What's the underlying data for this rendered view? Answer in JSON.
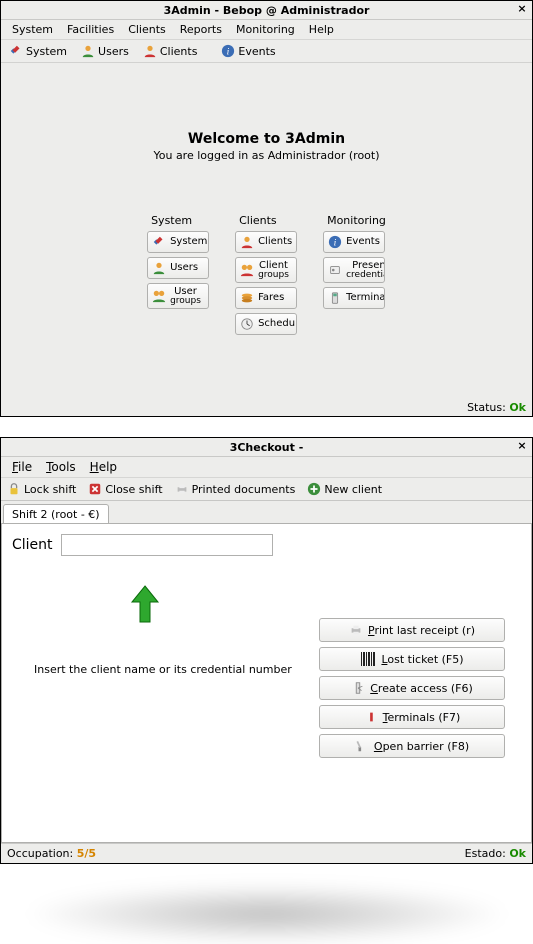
{
  "win1": {
    "title": "3Admin - Bebop @ Administrador",
    "menubar": [
      "System",
      "Facilities",
      "Clients",
      "Reports",
      "Monitoring",
      "Help"
    ],
    "toolbar": [
      {
        "icon": "tools",
        "label": "System"
      },
      {
        "icon": "user",
        "label": "Users"
      },
      {
        "icon": "client",
        "label": "Clients"
      },
      {
        "icon": "info",
        "label": "Events"
      }
    ],
    "welcome_title": "Welcome to 3Admin",
    "welcome_sub": "You are logged in as Administrador (root)",
    "sections": {
      "system": {
        "title": "System",
        "buttons": [
          "System",
          "Users",
          "User groups"
        ]
      },
      "clients": {
        "title": "Clients",
        "buttons": [
          "Clients",
          "Client groups",
          "Fares",
          "Schedules"
        ]
      },
      "monitoring": {
        "title": "Monitoring",
        "buttons": [
          "Events",
          "Present credentials",
          "Terminals"
        ]
      }
    },
    "status_label": "Status: ",
    "status_value": "Ok"
  },
  "win2": {
    "title": "3Checkout -",
    "menubar": [
      "File",
      "Tools",
      "Help"
    ],
    "toolbar": {
      "lock": "Lock shift",
      "close": "Close shift",
      "printed": "Printed documents",
      "new": "New client"
    },
    "tab_label": "Shift 2 (root - €)",
    "client_label": "Client",
    "client_value": "",
    "hint": "Insert the client name or its credential number",
    "buttons": {
      "print": {
        "u": "P",
        "rest": "rint last receipt (r)"
      },
      "lost": {
        "u": "L",
        "rest": "ost ticket (F5)"
      },
      "create": {
        "u": "C",
        "rest": "reate access (F6)"
      },
      "term": {
        "u": "T",
        "rest": "erminals (F7)"
      },
      "open": {
        "u": "O",
        "rest": "pen barrier (F8)"
      }
    },
    "occ_label": "Occupation: ",
    "occ_value": "5/5",
    "status_label": "Estado: ",
    "status_value": "Ok"
  }
}
